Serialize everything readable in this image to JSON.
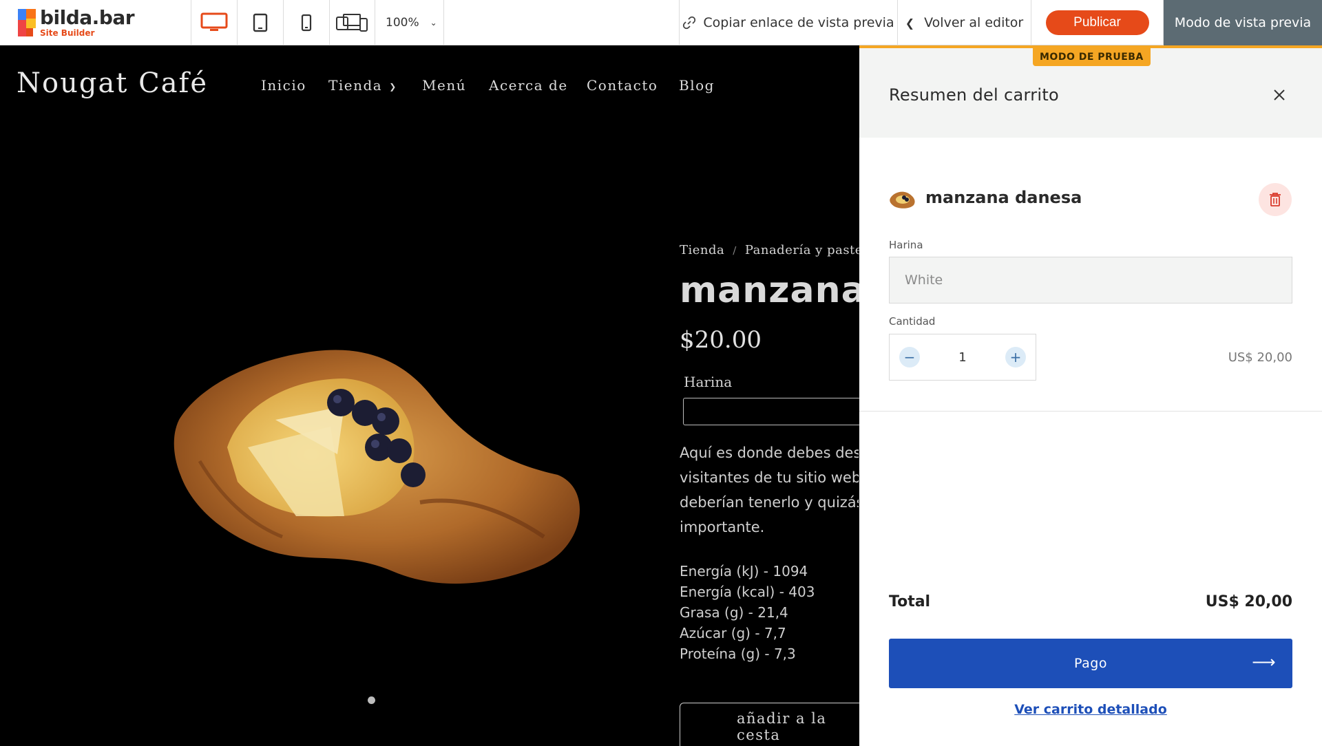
{
  "toolbar": {
    "logo_name": "bilda.bar",
    "logo_sub": "Site Builder",
    "zoom": "100%",
    "copy_link": "Copiar enlace de vista previa",
    "back_editor": "Volver al editor",
    "publish": "Publicar",
    "preview_mode": "Modo de vista previa",
    "accent_color": "#e64a19"
  },
  "site": {
    "title": "Nougat Café",
    "nav": [
      "Inicio",
      "Tienda",
      "Menú",
      "Acerca de",
      "Contacto",
      "Blog"
    ]
  },
  "product": {
    "breadcrumb": [
      "Tienda",
      "Panadería y pastele"
    ],
    "title": "manzana d",
    "price": "$20.00",
    "variant_label": "Harina",
    "description_lines": [
      "Aquí es donde debes desc",
      "visitantes de tu sitio web q",
      "deberían tenerlo y quizás o",
      "importante."
    ],
    "nutrition": [
      "Energía (kJ) - 1094",
      "Energía (kcal) - 403",
      "Grasa (g) - 21,4",
      "Azúcar (g) - 7,7",
      "Proteína (g) - 7,3"
    ],
    "add_to_cart": "añadir a la cesta"
  },
  "cart": {
    "test_badge": "MODO DE PRUEBA",
    "title": "Resumen del carrito",
    "item": {
      "name": "manzana danesa",
      "flour_label": "Harina",
      "flour_value": "White",
      "quantity_label": "Cantidad",
      "quantity": "1",
      "line_price": "US$ 20,00"
    },
    "total_label": "Total",
    "total_value": "US$ 20,00",
    "checkout": "Pago",
    "view_cart": "Ver carrito detallado",
    "button_color": "#1d4fb8",
    "badge_color": "#f5a623"
  }
}
